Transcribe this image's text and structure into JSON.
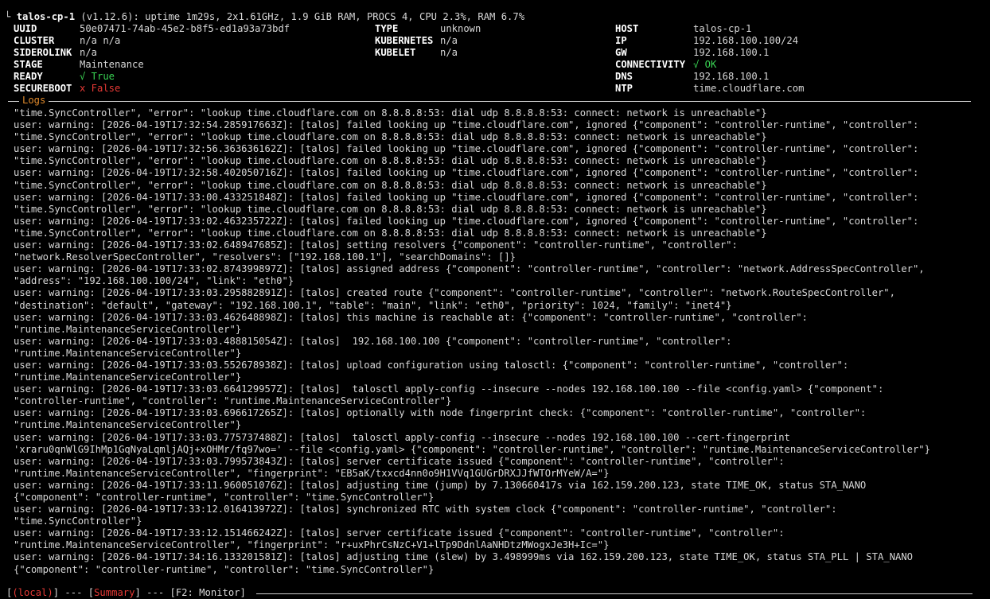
{
  "header": {
    "corner": "└",
    "node": "talos-cp-1",
    "summary": "(v1.12.6): uptime 1m29s, 2x1.61GHz, 1.9 GiB RAM, PROCS 4, CPU 2.3%, RAM 6.7%"
  },
  "info": {
    "uuid_label": "UUID",
    "uuid": "50e07471-74ab-45e2-b8f5-ed1a93a73bdf",
    "cluster_label": "CLUSTER",
    "cluster": "n/a n/a",
    "siderolink_label": "SIDEROLINK",
    "siderolink": "n/a",
    "stage_label": "STAGE",
    "stage": "Maintenance",
    "ready_label": "READY",
    "ready": "√ True",
    "secureboot_label": "SECUREBOOT",
    "secureboot": "x False",
    "type_label": "TYPE",
    "type": "unknown",
    "kubernetes_label": "KUBERNETES",
    "kubernetes": "n/a",
    "kubelet_label": "KUBELET",
    "kubelet": "n/a",
    "host_label": "HOST",
    "host": "talos-cp-1",
    "ip_label": "IP",
    "ip": "192.168.100.100/24",
    "gw_label": "GW",
    "gw": "192.168.100.1",
    "connectivity_label": "CONNECTIVITY",
    "connectivity": "√ OK",
    "dns_label": "DNS",
    "dns": "192.168.100.1",
    "ntp_label": "NTP",
    "ntp": "time.cloudflare.com"
  },
  "logs": {
    "title": "Logs",
    "lines": [
      "\"time.SyncController\", \"error\": \"lookup time.cloudflare.com on 8.8.8.8:53: dial udp 8.8.8.8:53: connect: network is unreachable\"}",
      "user: warning: [2026-04-19T17:32:54.285917663Z]: [talos] failed looking up \"time.cloudflare.com\", ignored {\"component\": \"controller-runtime\", \"controller\":",
      "\"time.SyncController\", \"error\": \"lookup time.cloudflare.com on 8.8.8.8:53: dial udp 8.8.8.8:53: connect: network is unreachable\"}",
      "user: warning: [2026-04-19T17:32:56.363636162Z]: [talos] failed looking up \"time.cloudflare.com\", ignored {\"component\": \"controller-runtime\", \"controller\":",
      "\"time.SyncController\", \"error\": \"lookup time.cloudflare.com on 8.8.8.8:53: dial udp 8.8.8.8:53: connect: network is unreachable\"}",
      "user: warning: [2026-04-19T17:32:58.402050716Z]: [talos] failed looking up \"time.cloudflare.com\", ignored {\"component\": \"controller-runtime\", \"controller\":",
      "\"time.SyncController\", \"error\": \"lookup time.cloudflare.com on 8.8.8.8:53: dial udp 8.8.8.8:53: connect: network is unreachable\"}",
      "user: warning: [2026-04-19T17:33:00.433251848Z]: [talos] failed looking up \"time.cloudflare.com\", ignored {\"component\": \"controller-runtime\", \"controller\":",
      "\"time.SyncController\", \"error\": \"lookup time.cloudflare.com on 8.8.8.8:53: dial udp 8.8.8.8:53: connect: network is unreachable\"}",
      "user: warning: [2026-04-19T17:33:02.463235722Z]: [talos] failed looking up \"time.cloudflare.com\", ignored {\"component\": \"controller-runtime\", \"controller\":",
      "\"time.SyncController\", \"error\": \"lookup time.cloudflare.com on 8.8.8.8:53: dial udp 8.8.8.8:53: connect: network is unreachable\"}",
      "user: warning: [2026-04-19T17:33:02.648947685Z]: [talos] setting resolvers {\"component\": \"controller-runtime\", \"controller\":",
      "\"network.ResolverSpecController\", \"resolvers\": [\"192.168.100.1\"], \"searchDomains\": []}",
      "user: warning: [2026-04-19T17:33:02.874399897Z]: [talos] assigned address {\"component\": \"controller-runtime\", \"controller\": \"network.AddressSpecController\",",
      "\"address\": \"192.168.100.100/24\", \"link\": \"eth0\"}",
      "user: warning: [2026-04-19T17:33:03.295882891Z]: [talos] created route {\"component\": \"controller-runtime\", \"controller\": \"network.RouteSpecController\",",
      "\"destination\": \"default\", \"gateway\": \"192.168.100.1\", \"table\": \"main\", \"link\": \"eth0\", \"priority\": 1024, \"family\": \"inet4\"}",
      "user: warning: [2026-04-19T17:33:03.462648898Z]: [talos] this machine is reachable at: {\"component\": \"controller-runtime\", \"controller\":",
      "\"runtime.MaintenanceServiceController\"}",
      "user: warning: [2026-04-19T17:33:03.488815054Z]: [talos]  192.168.100.100 {\"component\": \"controller-runtime\", \"controller\":",
      "\"runtime.MaintenanceServiceController\"}",
      "user: warning: [2026-04-19T17:33:03.552678938Z]: [talos] upload configuration using talosctl: {\"component\": \"controller-runtime\", \"controller\":",
      "\"runtime.MaintenanceServiceController\"}",
      "user: warning: [2026-04-19T17:33:03.664129957Z]: [talos]  talosctl apply-config --insecure --nodes 192.168.100.100 --file <config.yaml> {\"component\":",
      "\"controller-runtime\", \"controller\": \"runtime.MaintenanceServiceController\"}",
      "user: warning: [2026-04-19T17:33:03.696617265Z]: [talos] optionally with node fingerprint check: {\"component\": \"controller-runtime\", \"controller\":",
      "\"runtime.MaintenanceServiceController\"}",
      "user: warning: [2026-04-19T17:33:03.775737488Z]: [talos]  talosctl apply-config --insecure --nodes 192.168.100.100 --cert-fingerprint",
      "'xraru0qnWlG9IhMp1GqNyaLqmljAQj+xOHMr/fq97wo=' --file <config.yaml> {\"component\": \"controller-runtime\", \"controller\": \"runtime.MaintenanceServiceController\"}",
      "user: warning: [2026-04-19T17:33:03.799573843Z]: [talos] server certificate issued {\"component\": \"controller-runtime\", \"controller\":",
      "\"runtime.MaintenanceServiceController\", \"fingerprint\": \"EB5aK/txxcd4nn0o9H1VVq1GUGrDRXJJfWTOrMYeW/A=\"}",
      "user: warning: [2026-04-19T17:33:11.960051076Z]: [talos] adjusting time (jump) by 7.130660417s via 162.159.200.123, state TIME_OK, status STA_NANO",
      "{\"component\": \"controller-runtime\", \"controller\": \"time.SyncController\"}",
      "user: warning: [2026-04-19T17:33:12.016413972Z]: [talos] synchronized RTC with system clock {\"component\": \"controller-runtime\", \"controller\":",
      "\"time.SyncController\"}",
      "user: warning: [2026-04-19T17:33:12.151466242Z]: [talos] server certificate issued {\"component\": \"controller-runtime\", \"controller\":",
      "\"runtime.MaintenanceServiceController\", \"fingerprint\": \"r+uxPhrCsNzC+V1+lTp9DdnlAaNHDtzMWogxJe3H+Ic=\"}",
      "user: warning: [2026-04-19T17:34:16.133201581Z]: [talos] adjusting time (slew) by 3.498999ms via 162.159.200.123, state TIME_OK, status STA_PLL | STA_NANO",
      "{\"component\": \"controller-runtime\", \"controller\": \"time.SyncController\"}"
    ]
  },
  "footer": {
    "local_open": "[",
    "local": "(local)",
    "sep1": "] --- [",
    "summary": "Summary",
    "sep2": "] --- [F2: Monitor]"
  },
  "colors": {
    "ok": "#39d353",
    "error": "#e53935",
    "logs_title": "#e08a2c"
  }
}
